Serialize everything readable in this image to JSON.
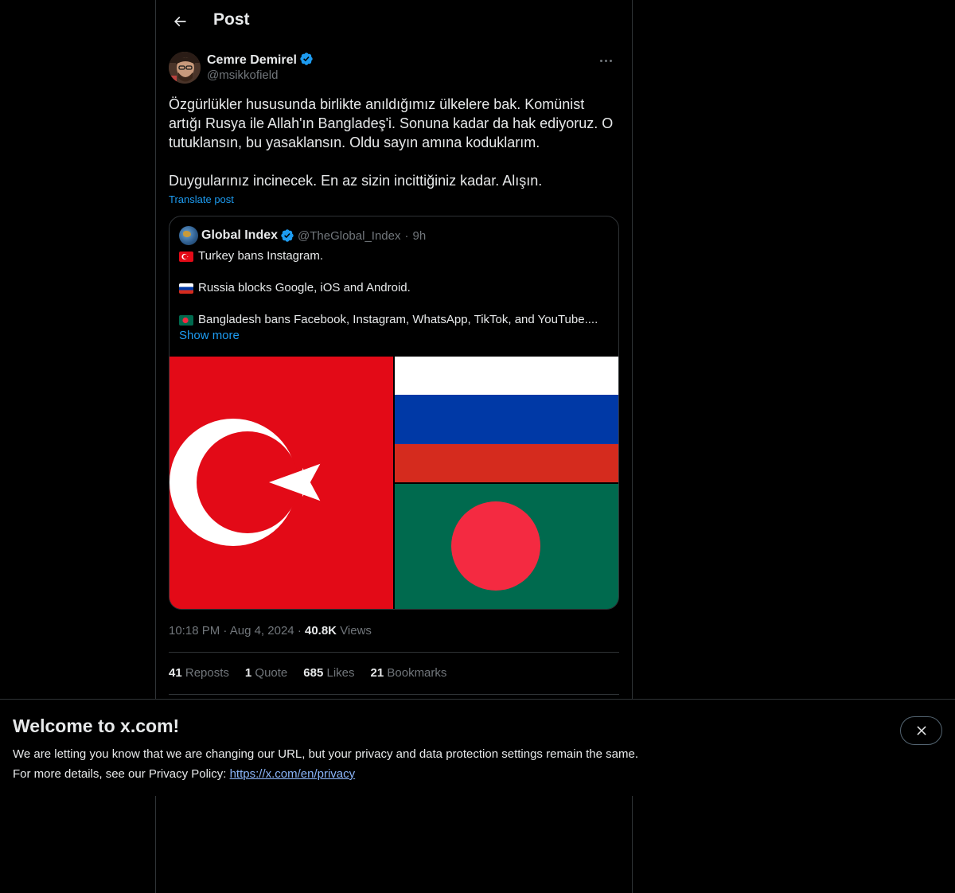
{
  "header": {
    "title": "Post"
  },
  "post": {
    "author_name": "Cemre Demirel",
    "author_handle": "@msikkofield",
    "paragraphs": [
      "Özgürlükler hususunda birlikte anıldığımız ülkelere bak. Komünist artığı Rusya ile Allah'ın Bangladeş'i. Sonuna kadar da hak ediyoruz. O tutuklansın, bu yasaklansın. Oldu sayın amına koduklarım.",
      "Duygularınız incinecek. En az sizin incittiğiniz kadar. Alışın."
    ],
    "translate_label": "Translate post",
    "time": "10:18 PM",
    "date": "Aug 4, 2024",
    "views_count": "40.8K",
    "views_label": "Views"
  },
  "quote": {
    "name": "Global Index",
    "handle": "@TheGlobal_Index",
    "time": "9h",
    "lines": [
      "Turkey bans Instagram.",
      "Russia blocks Google, iOS and Android.",
      "Bangladesh bans Facebook, Instagram, WhatsApp, TikTok, and YouTube...."
    ],
    "show_more": "Show more"
  },
  "stats": {
    "reposts_count": "41",
    "reposts_label": "Reposts",
    "quote_count": "1",
    "quote_label": "Quote",
    "likes_count": "685",
    "likes_label": "Likes",
    "bookmarks_count": "21",
    "bookmarks_label": "Bookmarks"
  },
  "banner": {
    "title": "Welcome to x.com!",
    "line1": "We are letting you know that we are changing our URL, but your privacy and data protection settings remain the same.",
    "line2_prefix": "For more details, see our Privacy Policy: ",
    "link": "https://x.com/en/privacy"
  },
  "colors": {
    "accent": "#1d9bf0",
    "background": "#000000",
    "border": "#2f3336",
    "muted_text": "#71767b"
  },
  "icons": [
    "back-arrow-icon",
    "verified-badge-icon",
    "more-icon",
    "close-icon"
  ]
}
